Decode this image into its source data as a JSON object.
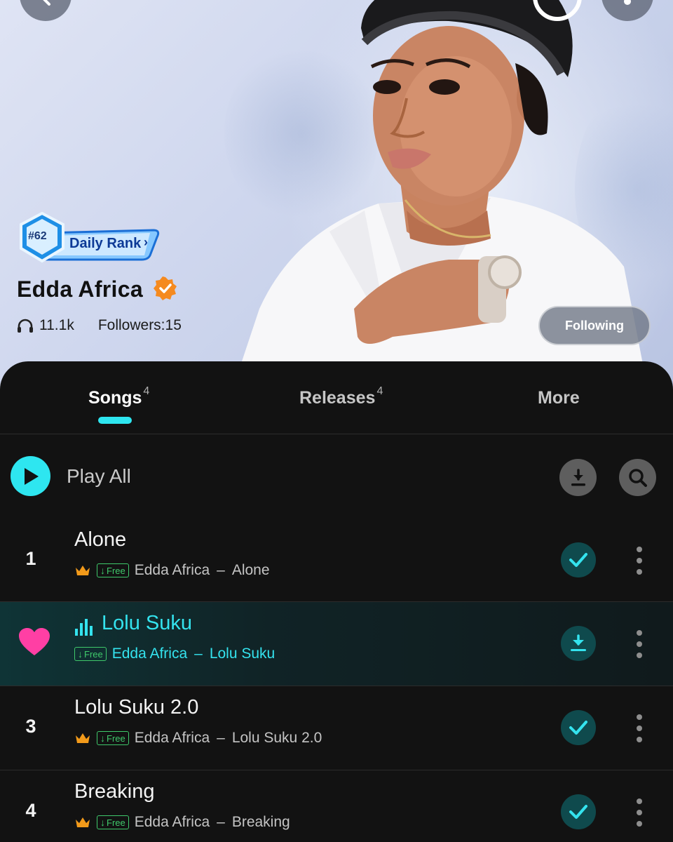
{
  "colors": {
    "accent": "#2ee6f0",
    "verified": "#f58a1f",
    "crown": "#f29a1a",
    "free_tag": "#3fc96b",
    "heart": "#ff3fa4",
    "panel_bg": "#121212"
  },
  "header": {
    "back_icon": "chevron-left-icon",
    "more_icon": "more-vertical-icon"
  },
  "rank": {
    "number": "#62",
    "label": "Daily Rank"
  },
  "artist": {
    "name": "Edda Africa",
    "verified_icon": "verified-badge-icon",
    "listens": "11.1k",
    "followers": "Followers:15",
    "follow_button": "Following"
  },
  "tabs": [
    {
      "label": "Songs",
      "count": "4",
      "active": true
    },
    {
      "label": "Releases",
      "count": "4",
      "active": false
    },
    {
      "label": "More",
      "count": "",
      "active": false
    }
  ],
  "toolbar": {
    "play_all": "Play All",
    "download_icon": "download-icon",
    "search_icon": "search-icon"
  },
  "songs": [
    {
      "index": "1",
      "title": "Alone",
      "free": "Free",
      "artist": "Edda Africa",
      "dash": "–",
      "album": "Alone",
      "state": "downloaded"
    },
    {
      "index": "",
      "title": "Lolu Suku",
      "free": "Free",
      "artist": "Edda Africa",
      "dash": "–",
      "album": "Lolu Suku",
      "state": "download",
      "playing": true
    },
    {
      "index": "3",
      "title": "Lolu Suku 2.0",
      "free": "Free",
      "artist": "Edda Africa",
      "dash": "–",
      "album": "Lolu Suku 2.0",
      "state": "downloaded"
    },
    {
      "index": "4",
      "title": "Breaking",
      "free": "Free",
      "artist": "Edda Africa",
      "dash": "–",
      "album": "Breaking",
      "state": "downloaded"
    }
  ]
}
